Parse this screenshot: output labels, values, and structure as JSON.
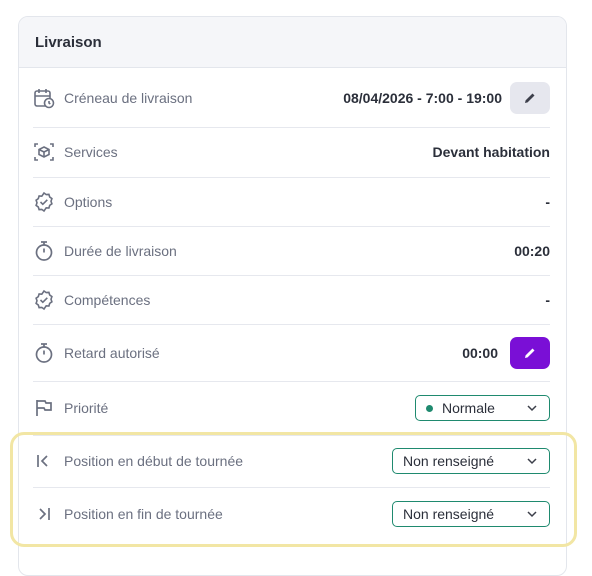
{
  "card": {
    "title": "Livraison"
  },
  "rows": [
    {
      "label": "Créneau de livraison",
      "value": "08/04/2026 - 7:00 - 19:00"
    },
    {
      "label": "Services",
      "value": "Devant habitation"
    },
    {
      "label": "Options",
      "value": "-"
    },
    {
      "label": "Durée de livraison",
      "value": "00:20"
    },
    {
      "label": "Compétences",
      "value": "-"
    },
    {
      "label": "Retard autorisé",
      "value": "00:00"
    },
    {
      "label": "Priorité",
      "value": "Normale",
      "dot_color": "#1f8a6f"
    },
    {
      "label": "Position en début de tournée",
      "value": "Non renseigné"
    },
    {
      "label": "Position en fin de tournée",
      "value": "Non renseigné"
    }
  ],
  "icons": {
    "creneau": "calendar-clock-icon",
    "services": "box-scan-icon",
    "options": "badge-check-icon",
    "duree": "stopwatch-icon",
    "competences": "badge-check-icon",
    "retard": "stopwatch-icon",
    "priorite": "flag-icon",
    "debut": "first-position-icon",
    "fin": "last-position-icon",
    "edit": "pencil-icon",
    "dropdown": "chevron-down-icon"
  },
  "colors": {
    "accent_purple": "#7a0fd6",
    "select_border": "#1f8a6f",
    "highlight": "#f2e6a4"
  }
}
